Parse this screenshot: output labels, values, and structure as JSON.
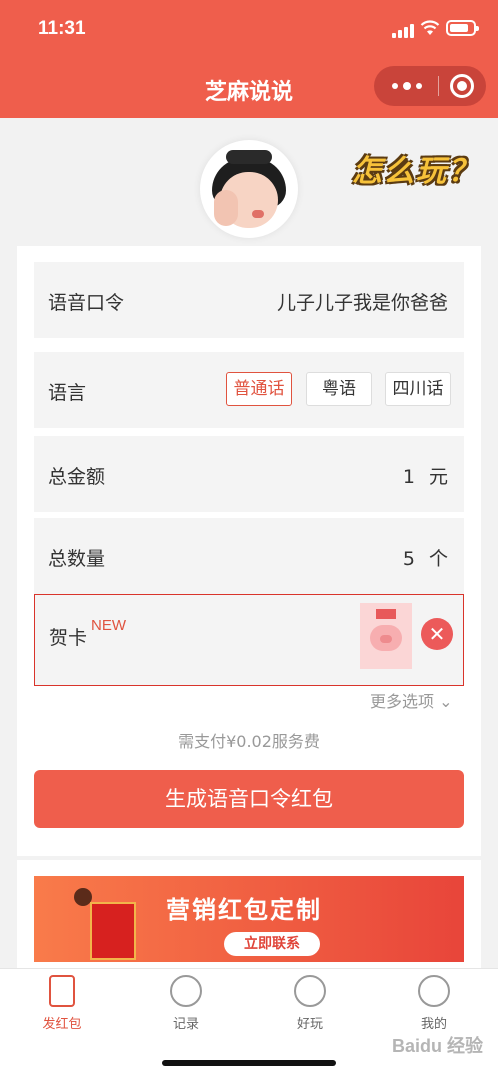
{
  "status": {
    "time": "11:31"
  },
  "nav": {
    "title": "芝麻说说"
  },
  "header": {
    "howto": "怎么玩？"
  },
  "form": {
    "voice_command": {
      "label": "语音口令",
      "value": "儿子儿子我是你爸爸"
    },
    "language": {
      "label": "语言",
      "options": [
        "普通话",
        "粤语",
        "四川话"
      ],
      "selected": "普通话"
    },
    "total_amount": {
      "label": "总金额",
      "value": "1",
      "unit": "元"
    },
    "total_count": {
      "label": "总数量",
      "value": "5",
      "unit": "个"
    },
    "greeting_card": {
      "label": "贺卡",
      "badge": "NEW"
    },
    "more_options": "更多选项",
    "fee_note": "需支付¥0.02服务费",
    "submit": "生成语音口令红包"
  },
  "banner": {
    "title": "营销红包定制",
    "button": "立即联系"
  },
  "tabs": [
    {
      "label": "发红包",
      "icon": "red-envelope-icon",
      "active": true
    },
    {
      "label": "记录",
      "icon": "list-icon",
      "active": false
    },
    {
      "label": "好玩",
      "icon": "gamepad-icon",
      "active": false
    },
    {
      "label": "我的",
      "icon": "user-icon",
      "active": false
    }
  ],
  "watermark": "Baidu 经验",
  "colors": {
    "brand": "#ef5e4c",
    "highlight": "#d9342b"
  }
}
